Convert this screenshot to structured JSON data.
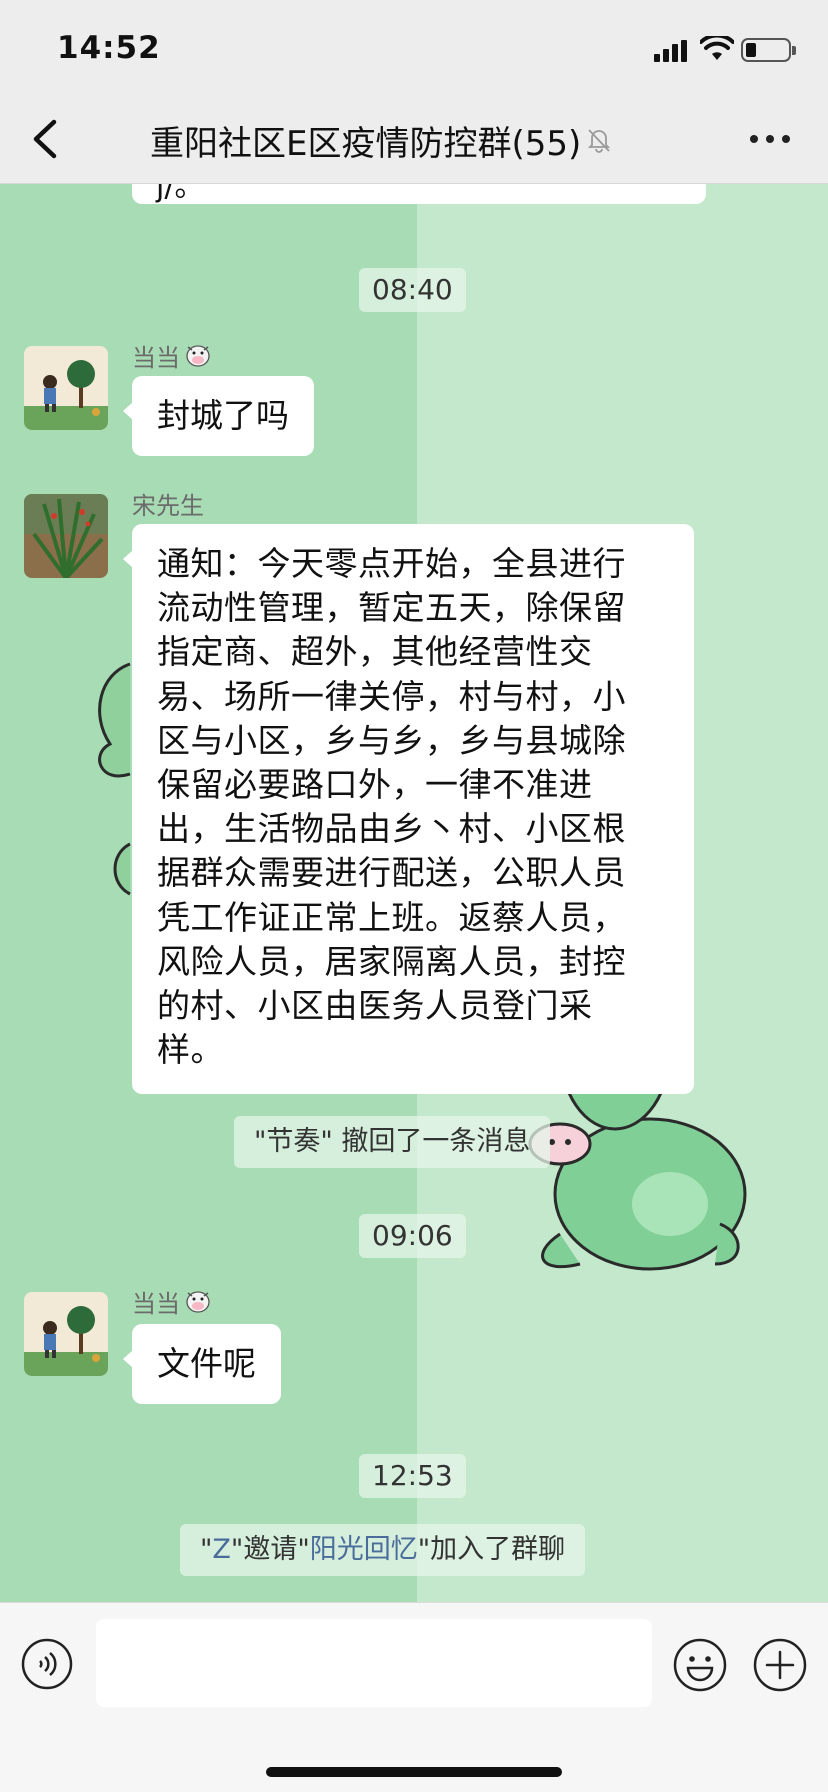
{
  "status_bar": {
    "time": "14:52"
  },
  "nav": {
    "title": "重阳社区E区疫情防控群(55)",
    "muted": true
  },
  "chat": {
    "top_partial_text": "j/。",
    "messages": [
      {
        "type": "time",
        "text": "08:40"
      },
      {
        "type": "msg",
        "sender": "当当",
        "sender_emoji": "cow-icon",
        "text": "封城了吗"
      },
      {
        "type": "msg",
        "sender": "宋先生",
        "text": "通知：今天零点开始，全县进行流动性管理，暂定五天，除保留指定商、超外，其他经营性交易、场所一律关停，村与村，小区与小区，乡与乡，乡与县城除保留必要路口外，一律不准进出，生活物品由乡丶村、小区根据群众需要进行配送，公职人员凭工作证正常上班。返蔡人员，风险人员，居家隔离人员，封控的村、小区由医务人员登门采样。",
        "lines": [
          "通知：今天零点开始，全县进行",
          "流动性管理，暂定五天，除保留",
          "指定商、超外，其他经营性交",
          "易、场所一律关停，村与村，小",
          "区与小区，乡与乡，乡与县城除",
          "保留必要路口外，一律不准进",
          "出，生活物品由乡丶村、小区根",
          "据群众需要进行配送，公职人员",
          "凭工作证正常上班。返蔡人员，",
          "风险人员，居家隔离人员，封控",
          "的村、小区由医务人员登门采",
          "样。"
        ]
      },
      {
        "type": "system",
        "text": "\"节奏\" 撤回了一条消息"
      },
      {
        "type": "time",
        "text": "09:06"
      },
      {
        "type": "msg",
        "sender": "当当",
        "sender_emoji": "cow-icon",
        "text": "文件呢"
      },
      {
        "type": "time",
        "text": "12:53"
      },
      {
        "type": "system_invite",
        "q1": "\"",
        "inviter": "Z",
        "q2": "\"邀请\"",
        "invitee": "阳光回忆",
        "q3": "\"加入了群聊"
      }
    ]
  },
  "colors": {
    "chat_bg_left": "#a8dcb5",
    "chat_bg_right": "#c3e8cc",
    "link": "#4a6c9b",
    "bubble": "#ffffff"
  }
}
